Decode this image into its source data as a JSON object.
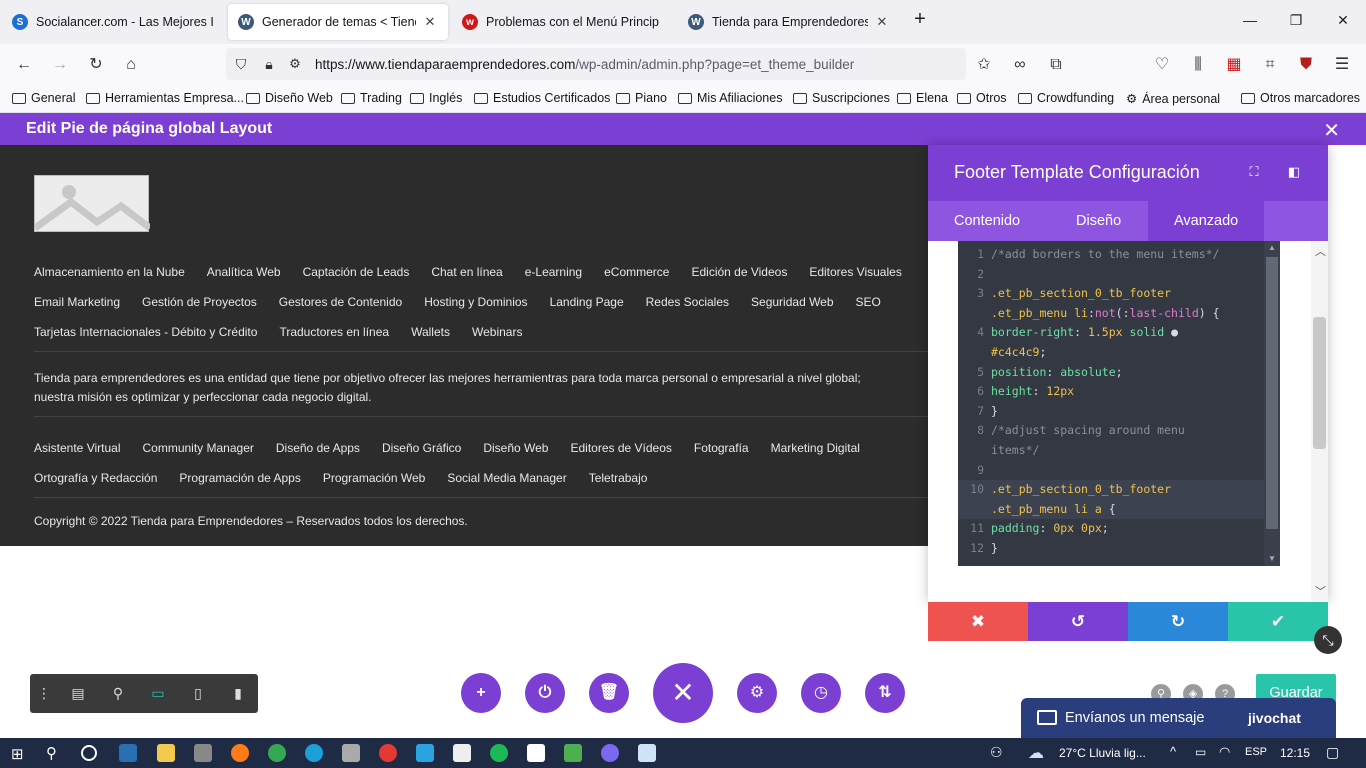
{
  "browser": {
    "tabs": [
      {
        "title": "Socialancer.com - Las Mejores I",
        "favicon": "socialancer-icon",
        "color": "#1d6fd8",
        "active": false
      },
      {
        "title": "Generador de temas < Tienda p",
        "favicon": "wordpress-icon",
        "color": "#3c5a78",
        "active": true
      },
      {
        "title": "Problemas con el Menú Princip",
        "favicon": "w-red-icon",
        "color": "#d01818",
        "active": false
      },
      {
        "title": "Tienda para Emprendedores | U",
        "favicon": "wordpress-icon",
        "color": "#3c5a78",
        "active": false
      }
    ],
    "url_domain": "https://www.tiendaparaemprendedores.com",
    "url_path": "/wp-admin/admin.php?page=et_theme_builder",
    "bookmarks": [
      "General",
      "Herramientas Empresa...",
      "Diseño Web",
      "Trading",
      "Inglés",
      "Estudios Certificados",
      "Piano",
      "Mis Afiliaciones",
      "Suscripciones",
      "Elena",
      "Otros",
      "Crowdfunding",
      "Área personal",
      "Otros marcadores"
    ],
    "badges": {
      "ext1": "1",
      "ext2": "5"
    }
  },
  "divi": {
    "header_title": "Edit Pie de página global Layout",
    "footer": {
      "menu1_row1": [
        "Almacenamiento en la Nube",
        "Analítica Web",
        "Captación de Leads",
        "Chat en línea",
        "e-Learning",
        "eCommerce",
        "Edición de Videos",
        "Editores Visuales"
      ],
      "menu1_row2": [
        "Email Marketing",
        "Gestión de Proyectos",
        "Gestores de Contenido",
        "Hosting y Dominios",
        "Landing Page",
        "Redes Sociales",
        "Seguridad Web",
        "SEO"
      ],
      "menu1_row3": [
        "Tarjetas Internacionales - Débito y Crédito",
        "Traductores en línea",
        "Wallets",
        "Webinars"
      ],
      "description": "Tienda para emprendedores es una entidad que tiene por objetivo ofrecer las mejores herramientras para toda marca personal o empresarial a nivel global; nuestra misión es optimizar y perfeccionar cada negocio digital.",
      "menu2_row1": [
        "Asistente Virtual",
        "Community Manager",
        "Diseño de Apps",
        "Diseño Gráfico",
        "Diseño Web",
        "Editores de Vídeos",
        "Fotografía",
        "Marketing Digital"
      ],
      "menu2_row2": [
        "Ortografía y Redacción",
        "Programación de Apps",
        "Programación Web",
        "Social Media Manager",
        "Teletrabajo"
      ],
      "copyright": "Copyright © 2022 Tienda para Emprendedores – Reservados todos los derechos."
    },
    "panel": {
      "title": "Footer Template Configuración",
      "tabs": [
        "Contenido",
        "Diseño",
        "Avanzado"
      ],
      "active_tab": "Avanzado",
      "code_lines": [
        {
          "n": "1",
          "parts": [
            [
              "c-com",
              "/*add borders to the menu items*/"
            ]
          ]
        },
        {
          "n": "2",
          "parts": []
        },
        {
          "n": "3",
          "parts": [
            [
              "c-sel",
              ".et_pb_section_0_tb_footer"
            ]
          ]
        },
        {
          "n": "",
          "parts": [
            [
              "c-sel",
              ".et_pb_menu li"
            ],
            [
              "c-txt",
              ":"
            ],
            [
              "c-kw",
              "not"
            ],
            [
              "c-txt",
              "(:"
            ],
            [
              "c-kw",
              "last-child"
            ],
            [
              "c-txt",
              ") {"
            ]
          ]
        },
        {
          "n": "4",
          "parts": [
            [
              "c-prop",
              "border-right"
            ],
            [
              "c-txt",
              ": "
            ],
            [
              "c-val",
              "1.5px"
            ],
            [
              "c-txt",
              " "
            ],
            [
              "c-prop",
              "solid"
            ],
            [
              "c-txt",
              " ● "
            ]
          ]
        },
        {
          "n": "",
          "parts": [
            [
              "c-val",
              "#c4c4c9"
            ],
            [
              "c-txt",
              ";"
            ]
          ]
        },
        {
          "n": "5",
          "parts": [
            [
              "c-prop",
              "position"
            ],
            [
              "c-txt",
              ": "
            ],
            [
              "c-prop",
              "absolute"
            ],
            [
              "c-txt",
              ";"
            ]
          ]
        },
        {
          "n": "6",
          "parts": [
            [
              "c-prop",
              "height"
            ],
            [
              "c-txt",
              ": "
            ],
            [
              "c-val",
              "12px"
            ]
          ]
        },
        {
          "n": "7",
          "parts": [
            [
              "c-txt",
              "}"
            ]
          ]
        },
        {
          "n": "8",
          "parts": [
            [
              "c-com",
              "/*adjust spacing around menu"
            ]
          ]
        },
        {
          "n": "",
          "parts": [
            [
              "c-com",
              "items*/"
            ]
          ]
        },
        {
          "n": "9",
          "parts": []
        },
        {
          "n": "10",
          "parts": [
            [
              "c-sel",
              ".et_pb_section_0_tb_footer"
            ]
          ]
        },
        {
          "n": "",
          "parts": [
            [
              "c-sel",
              ".et_pb_menu li a"
            ],
            [
              "c-txt",
              " {"
            ]
          ]
        },
        {
          "n": "11",
          "parts": [
            [
              "c-prop",
              "padding"
            ],
            [
              "c-txt",
              ": "
            ],
            [
              "c-val",
              "0px 0px"
            ],
            [
              "c-txt",
              ";"
            ]
          ]
        },
        {
          "n": "12",
          "parts": [
            [
              "c-txt",
              "}"
            ]
          ]
        }
      ]
    },
    "actions": {
      "cancel": "✖",
      "undo": "↺",
      "redo": "↻",
      "save": "✔"
    },
    "guardar": "Guardar",
    "chat_text": "Envíanos un mensaje",
    "chat_brand": "jivochat"
  },
  "taskbar": {
    "weather": "27°C  Lluvia lig...",
    "lang": "ESP",
    "time": "12:15"
  },
  "colors": {
    "divi_purple": "#7c3fd4",
    "cancel_red": "#ef5350",
    "undo_purple": "#7c3fd4",
    "redo_blue": "#2b87da",
    "save_green": "#29c4a9"
  }
}
